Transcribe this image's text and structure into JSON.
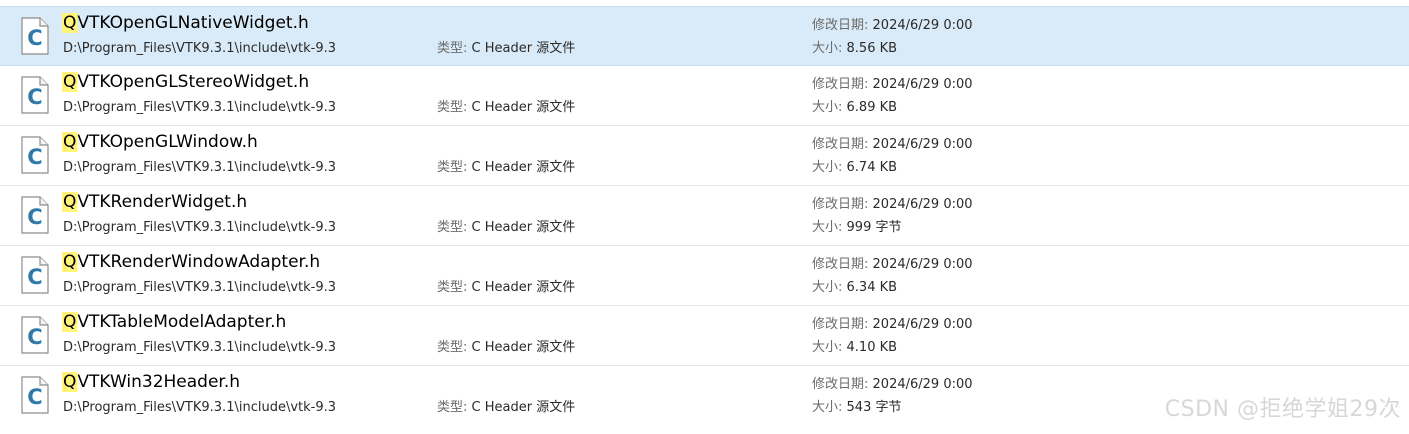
{
  "labels": {
    "type_label": "类型:",
    "modified_label": "修改日期:",
    "size_label": "大小:"
  },
  "query_highlight": "Q",
  "icon": {
    "name": "c-header-file-icon",
    "letter": "C",
    "accent": "#2f79a8"
  },
  "watermark": "CSDN @拒绝学姐29次",
  "results": [
    {
      "name_match": "Q",
      "name_rest": "VTKOpenGLNativeWidget.h",
      "path": "D:\\Program_Files\\VTK9.3.1\\include\\vtk-9.3",
      "type": "C Header 源文件",
      "modified": "2024/6/29 0:00",
      "size": "8.56 KB",
      "selected": true
    },
    {
      "name_match": "Q",
      "name_rest": "VTKOpenGLStereoWidget.h",
      "path": "D:\\Program_Files\\VTK9.3.1\\include\\vtk-9.3",
      "type": "C Header 源文件",
      "modified": "2024/6/29 0:00",
      "size": "6.89 KB",
      "selected": false
    },
    {
      "name_match": "Q",
      "name_rest": "VTKOpenGLWindow.h",
      "path": "D:\\Program_Files\\VTK9.3.1\\include\\vtk-9.3",
      "type": "C Header 源文件",
      "modified": "2024/6/29 0:00",
      "size": "6.74 KB",
      "selected": false
    },
    {
      "name_match": "Q",
      "name_rest": "VTKRenderWidget.h",
      "path": "D:\\Program_Files\\VTK9.3.1\\include\\vtk-9.3",
      "type": "C Header 源文件",
      "modified": "2024/6/29 0:00",
      "size": "999 字节",
      "selected": false
    },
    {
      "name_match": "Q",
      "name_rest": "VTKRenderWindowAdapter.h",
      "path": "D:\\Program_Files\\VTK9.3.1\\include\\vtk-9.3",
      "type": "C Header 源文件",
      "modified": "2024/6/29 0:00",
      "size": "6.34 KB",
      "selected": false
    },
    {
      "name_match": "Q",
      "name_rest": "VTKTableModelAdapter.h",
      "path": "D:\\Program_Files\\VTK9.3.1\\include\\vtk-9.3",
      "type": "C Header 源文件",
      "modified": "2024/6/29 0:00",
      "size": "4.10 KB",
      "selected": false
    },
    {
      "name_match": "Q",
      "name_rest": "VTKWin32Header.h",
      "path": "D:\\Program_Files\\VTK9.3.1\\include\\vtk-9.3",
      "type": "C Header 源文件",
      "modified": "2024/6/29 0:00",
      "size": "543 字节",
      "selected": false
    }
  ]
}
